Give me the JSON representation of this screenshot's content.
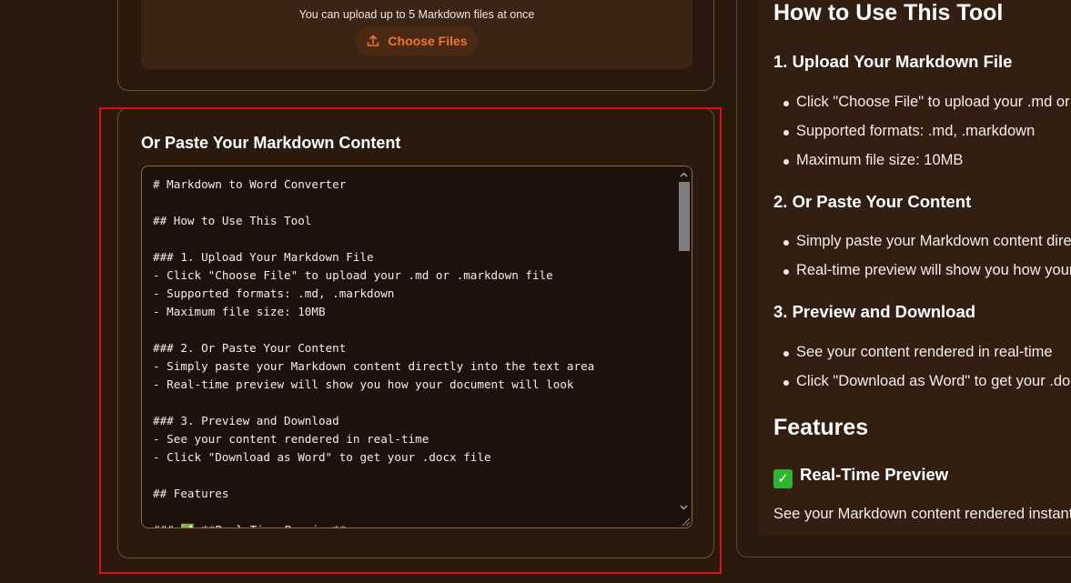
{
  "upload": {
    "hint": "You can upload up to 5 Markdown files at once",
    "button_label": "Choose Files",
    "button_icon": "upload-icon"
  },
  "paste": {
    "title": "Or Paste Your Markdown Content",
    "content": "# Markdown to Word Converter\n\n## How to Use This Tool\n\n### 1. Upload Your Markdown File\n- Click \"Choose File\" to upload your .md or .markdown file\n- Supported formats: .md, .markdown\n- Maximum file size: 10MB\n\n### 2. Or Paste Your Content\n- Simply paste your Markdown content directly into the text area\n- Real-time preview will show you how your document will look\n\n### 3. Preview and Download\n- See your content rendered in real-time\n- Click \"Download as Word\" to get your .docx file\n\n## Features\n\n### ✅ **Real-Time Preview**"
  },
  "preview": {
    "title": "How to Use This Tool",
    "step1": {
      "heading": "1. Upload Your Markdown File",
      "items": [
        "Click \"Choose File\" to upload your .md or .markdown file",
        "Supported formats: .md, .markdown",
        "Maximum file size: 10MB"
      ]
    },
    "step2": {
      "heading": "2. Or Paste Your Content",
      "items": [
        "Simply paste your Markdown content directly into the text area",
        "Real-time preview will show you how your document will look"
      ]
    },
    "step3": {
      "heading": "3. Preview and Download",
      "items": [
        "See your content rendered in real-time",
        "Click \"Download as Word\" to get your .docx file"
      ]
    },
    "features_title": "Features",
    "feature1_heading": "Real-Time Preview",
    "feature1_icon": "check-mark-icon",
    "feature1_text": "See your Markdown content rendered instantly"
  },
  "colors": {
    "background": "#2a1a0e",
    "accent": "#f2762a",
    "highlight": "#e01010"
  }
}
